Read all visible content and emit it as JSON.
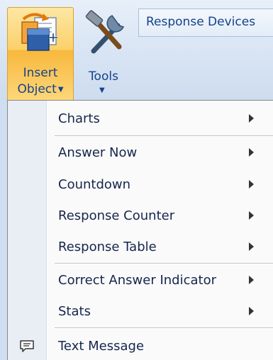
{
  "ribbon": {
    "insert_object": {
      "line1": "Insert",
      "line2": "Object",
      "icon": "insert-object-icon"
    },
    "tools": {
      "label": "Tools",
      "icon": "tools-icon"
    },
    "response_devices": {
      "label": "Response Devices"
    }
  },
  "menu": {
    "items": [
      {
        "label": "Charts",
        "has_submenu": true
      },
      {
        "label": "Answer Now",
        "has_submenu": true
      },
      {
        "label": "Countdown",
        "has_submenu": true
      },
      {
        "label": "Response Counter",
        "has_submenu": true
      },
      {
        "label": "Response Table",
        "has_submenu": true
      },
      {
        "label": "Correct Answer Indicator",
        "has_submenu": true
      },
      {
        "label": "Stats",
        "has_submenu": true
      },
      {
        "label": "Text Message",
        "has_submenu": false,
        "icon": "text-message-icon"
      }
    ]
  },
  "colors": {
    "ribbon_text": "#15428b",
    "menu_text": "#15264d",
    "highlight_orange": "#f8b83c"
  }
}
